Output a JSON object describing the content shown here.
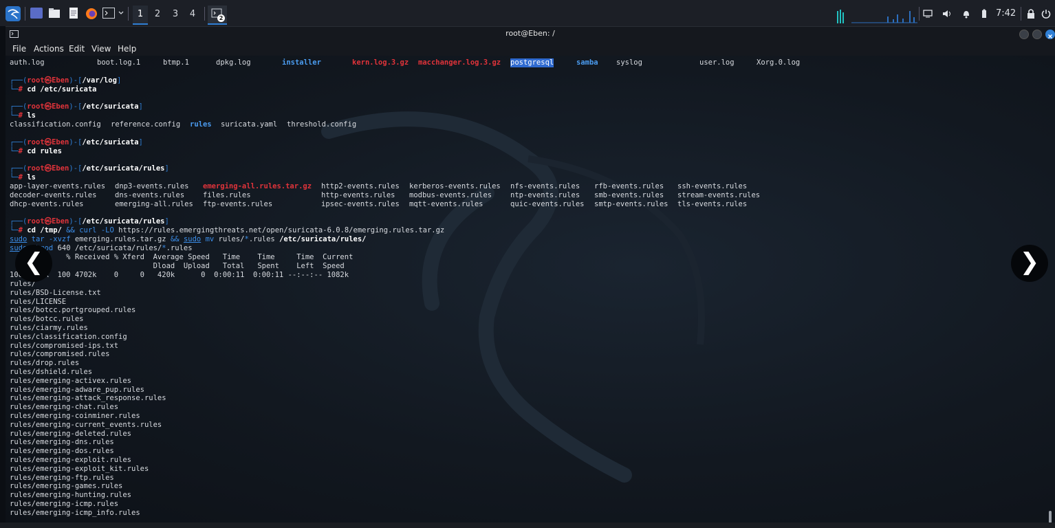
{
  "taskbar": {
    "workspaces": [
      "1",
      "2",
      "3",
      "4"
    ],
    "active_workspace": "1",
    "terminal_badge": "2",
    "clock": "7:42",
    "icons": [
      "kali-menu-icon",
      "desktop-icon",
      "file-manager-icon",
      "text-editor-icon",
      "firefox-icon",
      "terminal-icon",
      "chevron-down-icon",
      "terminal-window-icon",
      "cpu-graph",
      "network-graph",
      "display-icon",
      "volume-icon",
      "bell-icon",
      "battery-icon",
      "lock-icon",
      "power-icon"
    ]
  },
  "window": {
    "title": "root@Eben: /",
    "menu": [
      "File",
      "Actions",
      "Edit",
      "View",
      "Help"
    ]
  },
  "terminal": {
    "row0": {
      "auth": "auth.log",
      "boot": "boot.log.1",
      "btmp": "btmp.1",
      "dpkg": "dpkg.log",
      "installer": "installer",
      "kern": "kern.log.3.gz",
      "macchanger": "macchanger.log.3.gz",
      "postgresql": "postgresql",
      "samba": "samba",
      "syslog": "syslog",
      "user": "user.log",
      "xorg": "Xorg.0.log"
    },
    "prompt_user": "root",
    "prompt_host": "Eben",
    "prompt_at": "㉿",
    "p1_path": "/var/log",
    "p1_cmd": "cd /etc/suricata",
    "p2_path": "/etc/suricata",
    "p2_cmd": "ls",
    "ls1": {
      "classification": "classification.config",
      "reference": "reference.config",
      "rules": "rules",
      "suricata": "suricata.yaml",
      "threshold": "threshold.config"
    },
    "p3_path": "/etc/suricata",
    "p3_cmd": "cd rules",
    "p4_path": "/etc/suricata/rules",
    "p4_cmd": "ls",
    "ls2": {
      "r1": [
        "app-layer-events.rules",
        "dnp3-events.rules",
        "emerging-all.rules.tar.gz",
        "http2-events.rules",
        "kerberos-events.rules",
        "nfs-events.rules",
        "rfb-events.rules",
        "ssh-events.rules"
      ],
      "r2": [
        "decoder-events.rules",
        "dns-events.rules",
        "files.rules",
        "http-events.rules",
        "modbus-events.rules",
        "ntp-events.rules",
        "smb-events.rules",
        "stream-events.rules"
      ],
      "r3": [
        "dhcp-events.rules",
        "emerging-all.rules",
        "ftp-events.rules",
        "ipsec-events.rules",
        "mqtt-events.rules",
        "quic-events.rules",
        "smtp-events.rules",
        "tls-events.rules"
      ]
    },
    "p5_path": "/etc/suricata/rules",
    "cmd5": {
      "cd": "cd",
      "tmp": "/tmp/",
      "and1": "&&",
      "curl": "curl",
      "flag": "-LO",
      "url": "https://rules.emergingthreats.net/open/suricata-6.0.8/emerging.rules.tar.gz",
      "sudo1": "sudo",
      "tar": "tar",
      "tarflags": "-xvzf",
      "tarfile": "emerging.rules.tar.gz",
      "and2": "&&",
      "sudo2": "sudo",
      "mv": "mv",
      "mvsrc_a": "rules/",
      "star1": "*",
      "mvsrc_b": ".rules",
      "mvdst": "/etc/suricata/rules/",
      "sudo3": "sudo",
      "chmod": "chmod",
      "chmodargs_a": "640 /etc/suricata/rules/",
      "star2": "*",
      "chmodargs_b": ".rules"
    },
    "curl_header1": "  % Total    % Received % Xferd  Average Speed   Time    Time     Time  Current",
    "curl_header2": "                                 Dload  Upload   Total   Spent    Left  Speed",
    "curl_progress": "100 4702k  100 4702k    0     0   420k      0  0:00:11  0:00:11 --:--:-- 1082k",
    "extracted": [
      "rules/",
      "rules/BSD-License.txt",
      "rules/LICENSE",
      "rules/botcc.portgrouped.rules",
      "rules/botcc.rules",
      "rules/ciarmy.rules",
      "rules/classification.config",
      "rules/compromised-ips.txt",
      "rules/compromised.rules",
      "rules/drop.rules",
      "rules/dshield.rules",
      "rules/emerging-activex.rules",
      "rules/emerging-adware_pup.rules",
      "rules/emerging-attack_response.rules",
      "rules/emerging-chat.rules",
      "rules/emerging-coinminer.rules",
      "rules/emerging-current_events.rules",
      "rules/emerging-deleted.rules",
      "rules/emerging-dns.rules",
      "rules/emerging-dos.rules",
      "rules/emerging-exploit.rules",
      "rules/emerging-exploit_kit.rules",
      "rules/emerging-ftp.rules",
      "rules/emerging-games.rules",
      "rules/emerging-hunting.rules",
      "rules/emerging-icmp.rules",
      "rules/emerging-icmp_info.rules"
    ]
  },
  "nav": {
    "prev": "❮",
    "next": "❯"
  },
  "colors": {
    "prompt_frame": "#2f7fd5",
    "prompt_root": "#e0333a",
    "dir_blue": "#3b8eea",
    "archive_red": "#e0333a"
  }
}
